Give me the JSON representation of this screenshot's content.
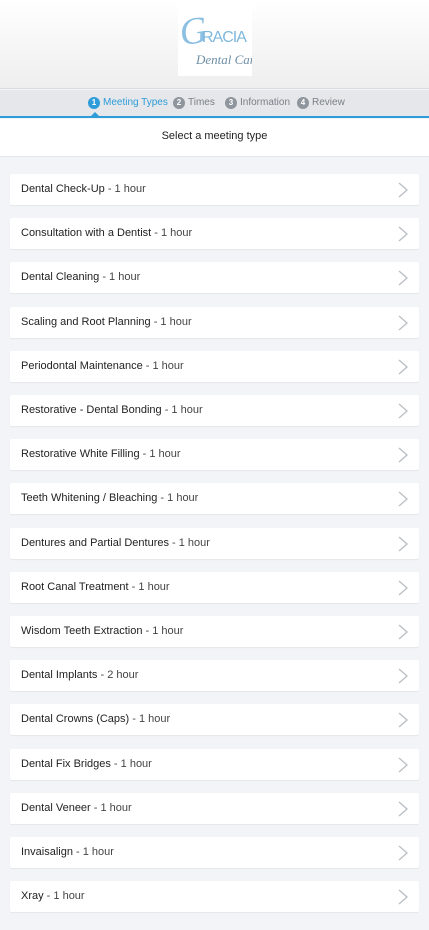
{
  "brand": {
    "logo_line1": "GRACIA",
    "logo_line2": "Dental Care",
    "logo_color": "#7fb7dc"
  },
  "steps": [
    {
      "num": "1",
      "label": "Meeting Types",
      "active": true
    },
    {
      "num": "2",
      "label": "Times",
      "active": false
    },
    {
      "num": "3",
      "label": "Information",
      "active": false
    },
    {
      "num": "4",
      "label": "Review",
      "active": false
    }
  ],
  "accent_color": "#2e9cd8",
  "page": {
    "subtitle": "Select a meeting type"
  },
  "meeting_types": [
    {
      "name": "Dental Check-Up",
      "duration": " - 1 hour"
    },
    {
      "name": "Consultation with a Dentist",
      "duration": " - 1 hour"
    },
    {
      "name": "Dental Cleaning",
      "duration": " - 1 hour"
    },
    {
      "name": "Scaling and Root Planning",
      "duration": " - 1 hour"
    },
    {
      "name": "Periodontal Maintenance",
      "duration": " - 1 hour"
    },
    {
      "name": "Restorative - Dental Bonding",
      "duration": " - 1 hour"
    },
    {
      "name": "Restorative White Filling",
      "duration": " - 1 hour"
    },
    {
      "name": "Teeth Whitening / Bleaching",
      "duration": " - 1 hour"
    },
    {
      "name": "Dentures and Partial Dentures",
      "duration": " - 1 hour"
    },
    {
      "name": "Root Canal Treatment",
      "duration": " - 1 hour"
    },
    {
      "name": "Wisdom Teeth Extraction",
      "duration": " - 1 hour"
    },
    {
      "name": "Dental Implants",
      "duration": " - 2 hour"
    },
    {
      "name": "Dental Crowns (Caps)",
      "duration": " - 1 hour"
    },
    {
      "name": "Dental Fix Bridges",
      "duration": " - 1 hour"
    },
    {
      "name": "Dental Veneer",
      "duration": " - 1 hour"
    },
    {
      "name": "Invaisalign",
      "duration": " - 1 hour"
    },
    {
      "name": "Xray",
      "duration": " - 1 hour"
    }
  ]
}
